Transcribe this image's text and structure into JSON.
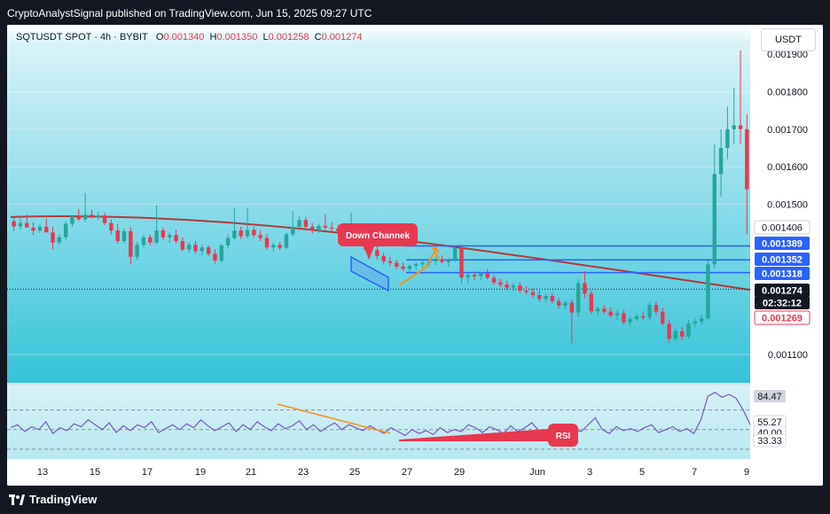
{
  "header": {
    "publisher_line": "CryptoAnalystSignal published on TradingView.com, Jun 15, 2025 09:27 UTC"
  },
  "legend": {
    "symbol": "SQTUSDT SPOT · 4h · BYBIT",
    "o_label": "O",
    "o_value": "0.001340",
    "h_label": "H",
    "h_value": "0.001350",
    "l_label": "L",
    "l_value": "0.001258",
    "c_label": "C",
    "c_value": "0.001274"
  },
  "currency": "USDT",
  "footer": {
    "brand": "TradingView"
  },
  "colors": {
    "up": "#26a69a",
    "down": "#e8384f",
    "ma": "#b33a3a",
    "level": "#2962ff",
    "orange": "#f7931a",
    "rsi": "#7e57c2",
    "label_red": "#e8384f",
    "label_dark": "#131722",
    "bg_top": "#d9f3f8",
    "bg_bottom": "#35c3d8"
  },
  "chart_data": {
    "type": "candlestick",
    "price_axis": {
      "ylim": [
        0.001,
        0.00193
      ],
      "ticks": [
        "0.001100",
        "0.001500",
        "0.001600",
        "0.001700",
        "0.001800",
        "0.001900"
      ]
    },
    "x_axis": {
      "ticks": [
        "13",
        "15",
        "17",
        "19",
        "21",
        "23",
        "25",
        "27",
        "29",
        "Jun",
        "3",
        "5",
        "7",
        "9"
      ]
    },
    "candles": [
      [
        0.001455,
        0.001465,
        0.001428,
        0.001441
      ],
      [
        0.001441,
        0.001462,
        0.001432,
        0.00145
      ],
      [
        0.00145,
        0.001472,
        0.00144,
        0.001438
      ],
      [
        0.001438,
        0.001452,
        0.001418,
        0.00143
      ],
      [
        0.00143,
        0.001448,
        0.001424,
        0.00144
      ],
      [
        0.00144,
        0.001462,
        0.00143,
        0.001425
      ],
      [
        0.001425,
        0.00144,
        0.00138,
        0.001398
      ],
      [
        0.001398,
        0.00142,
        0.001392,
        0.001412
      ],
      [
        0.001412,
        0.001455,
        0.001405,
        0.001448
      ],
      [
        0.001448,
        0.001472,
        0.00144,
        0.001468
      ],
      [
        0.001468,
        0.001488,
        0.001456,
        0.00146
      ],
      [
        0.00146,
        0.00153,
        0.001452,
        0.001472
      ],
      [
        0.001472,
        0.001485,
        0.001462,
        0.001466
      ],
      [
        0.001466,
        0.00148,
        0.001458,
        0.00147
      ],
      [
        0.00147,
        0.001478,
        0.001444,
        0.00145
      ],
      [
        0.00145,
        0.00146,
        0.00142,
        0.00143
      ],
      [
        0.00143,
        0.001448,
        0.001395,
        0.001402
      ],
      [
        0.001402,
        0.001435,
        0.001396,
        0.001428
      ],
      [
        0.001428,
        0.00144,
        0.00134,
        0.00136
      ],
      [
        0.00136,
        0.0014,
        0.001352,
        0.001392
      ],
      [
        0.001392,
        0.00142,
        0.001385,
        0.001412
      ],
      [
        0.001412,
        0.00142,
        0.00139,
        0.001398
      ],
      [
        0.001398,
        0.001498,
        0.001395,
        0.00143
      ],
      [
        0.00143,
        0.001438,
        0.001405,
        0.001412
      ],
      [
        0.001412,
        0.001425,
        0.001398,
        0.001418
      ],
      [
        0.001418,
        0.001432,
        0.001395,
        0.001402
      ],
      [
        0.001402,
        0.001412,
        0.001375,
        0.00138
      ],
      [
        0.00138,
        0.0014,
        0.00137,
        0.001392
      ],
      [
        0.001392,
        0.001402,
        0.001368,
        0.001375
      ],
      [
        0.001375,
        0.001392,
        0.001365,
        0.001385
      ],
      [
        0.001385,
        0.00139,
        0.001362,
        0.001368
      ],
      [
        0.001368,
        0.00138,
        0.001342,
        0.00135
      ],
      [
        0.00135,
        0.001395,
        0.001345,
        0.00139
      ],
      [
        0.00139,
        0.00142,
        0.001382,
        0.00141
      ],
      [
        0.00141,
        0.00149,
        0.001405,
        0.00143
      ],
      [
        0.00143,
        0.00144,
        0.001408,
        0.001415
      ],
      [
        0.001415,
        0.00149,
        0.00141,
        0.001432
      ],
      [
        0.001432,
        0.00144,
        0.001412,
        0.001418
      ],
      [
        0.001418,
        0.00143,
        0.001402,
        0.00141
      ],
      [
        0.00141,
        0.00142,
        0.001378,
        0.001385
      ],
      [
        0.001385,
        0.001398,
        0.001375,
        0.001392
      ],
      [
        0.001392,
        0.0014,
        0.001378,
        0.001384
      ],
      [
        0.001384,
        0.001425,
        0.00138,
        0.00142
      ],
      [
        0.00142,
        0.001482,
        0.001415,
        0.00144
      ],
      [
        0.00144,
        0.001468,
        0.00143,
        0.001458
      ],
      [
        0.001458,
        0.001466,
        0.001432,
        0.00144
      ],
      [
        0.00144,
        0.00145,
        0.001422,
        0.00143
      ],
      [
        0.00143,
        0.001448,
        0.001424,
        0.001442
      ],
      [
        0.001442,
        0.001474,
        0.001432,
        0.001438
      ],
      [
        0.001438,
        0.001452,
        0.001426,
        0.001436
      ],
      [
        0.001436,
        0.001446,
        0.00142,
        0.001428
      ],
      [
        0.001428,
        0.00144,
        0.001405,
        0.001412
      ],
      [
        0.001412,
        0.001478,
        0.001408,
        0.001418
      ],
      [
        0.001418,
        0.001428,
        0.001392,
        0.001398
      ],
      [
        0.001398,
        0.00141,
        0.00138,
        0.00139
      ],
      [
        0.00139,
        0.001402,
        0.00137,
        0.001378
      ],
      [
        0.001378,
        0.001388,
        0.001352,
        0.001362
      ],
      [
        0.001362,
        0.001372,
        0.00134,
        0.001348
      ],
      [
        0.001348,
        0.00136,
        0.001336,
        0.001344
      ],
      [
        0.001344,
        0.001352,
        0.001328,
        0.001334
      ],
      [
        0.001334,
        0.001345,
        0.001322,
        0.001328
      ],
      [
        0.001328,
        0.00134,
        0.001318,
        0.001336
      ],
      [
        0.001336,
        0.001346,
        0.001326,
        0.00134
      ],
      [
        0.00134,
        0.00135,
        0.00133,
        0.001344
      ],
      [
        0.001344,
        0.001356,
        0.001334,
        0.001348
      ],
      [
        0.001348,
        0.00136,
        0.001338,
        0.001352
      ],
      [
        0.001352,
        0.001364,
        0.001342,
        0.001346
      ],
      [
        0.001346,
        0.001358,
        0.001334,
        0.001352
      ],
      [
        0.001352,
        0.00139,
        0.001346,
        0.001384
      ],
      [
        0.001384,
        0.001392,
        0.00129,
        0.001305
      ],
      [
        0.001305,
        0.001318,
        0.00129,
        0.001312
      ],
      [
        0.001312,
        0.001322,
        0.001298,
        0.001308
      ],
      [
        0.001308,
        0.00132,
        0.001298,
        0.001316
      ],
      [
        0.001316,
        0.001328,
        0.0013,
        0.001304
      ],
      [
        0.001304,
        0.001312,
        0.001285,
        0.001292
      ],
      [
        0.001292,
        0.001302,
        0.00128,
        0.001286
      ],
      [
        0.001286,
        0.001296,
        0.001272,
        0.001278
      ],
      [
        0.001278,
        0.00129,
        0.001268,
        0.001284
      ],
      [
        0.001284,
        0.001292,
        0.001264,
        0.00127
      ],
      [
        0.00127,
        0.001282,
        0.00126,
        0.001266
      ],
      [
        0.001266,
        0.001276,
        0.001252,
        0.001258
      ],
      [
        0.001258,
        0.00127,
        0.00124,
        0.001248
      ],
      [
        0.001248,
        0.001262,
        0.001238,
        0.001256
      ],
      [
        0.001256,
        0.001264,
        0.001236,
        0.001242
      ],
      [
        0.001242,
        0.00125,
        0.001222,
        0.00123
      ],
      [
        0.00123,
        0.001244,
        0.00122,
        0.001238
      ],
      [
        0.001238,
        0.001246,
        0.00113,
        0.001212
      ],
      [
        0.001212,
        0.0013,
        0.0012,
        0.00129
      ],
      [
        0.00129,
        0.001322,
        0.00125,
        0.001262
      ],
      [
        0.001262,
        0.00127,
        0.001208,
        0.001215
      ],
      [
        0.001215,
        0.001228,
        0.001205,
        0.001222
      ],
      [
        0.001222,
        0.001232,
        0.001208,
        0.001214
      ],
      [
        0.001214,
        0.001225,
        0.001198,
        0.001204
      ],
      [
        0.001204,
        0.001218,
        0.001192,
        0.00121
      ],
      [
        0.00121,
        0.00122,
        0.00118,
        0.001186
      ],
      [
        0.001186,
        0.0012,
        0.001174,
        0.001194
      ],
      [
        0.001194,
        0.00121,
        0.001188,
        0.001202
      ],
      [
        0.001202,
        0.001214,
        0.00119,
        0.001198
      ],
      [
        0.001198,
        0.00124,
        0.001192,
        0.001232
      ],
      [
        0.001232,
        0.00124,
        0.001205,
        0.001214
      ],
      [
        0.001214,
        0.001224,
        0.001176,
        0.001182
      ],
      [
        0.001182,
        0.001192,
        0.00113,
        0.001142
      ],
      [
        0.001142,
        0.00117,
        0.001136,
        0.001162
      ],
      [
        0.001162,
        0.001174,
        0.001138,
        0.001148
      ],
      [
        0.001148,
        0.001192,
        0.001142,
        0.001182
      ],
      [
        0.001182,
        0.001196,
        0.001174,
        0.001188
      ],
      [
        0.001188,
        0.001206,
        0.001178,
        0.001196
      ],
      [
        0.001196,
        0.00135,
        0.00119,
        0.00134
      ],
      [
        0.00134,
        0.00166,
        0.00133,
        0.00158
      ],
      [
        0.00158,
        0.0017,
        0.00152,
        0.00165
      ],
      [
        0.00165,
        0.00176,
        0.00162,
        0.0017
      ],
      [
        0.0017,
        0.00181,
        0.00166,
        0.00171
      ],
      [
        0.00171,
        0.00191,
        0.00166,
        0.0017
      ],
      [
        0.0017,
        0.00174,
        0.00142,
        0.00154
      ]
    ],
    "moving_average_start": 0.001466,
    "moving_average_end": 0.001272,
    "horizontal_levels": [
      0.001389,
      0.001352,
      0.001318
    ],
    "last_close": 0.001274,
    "price_labels": [
      {
        "value": "0.001406",
        "style": "plain"
      },
      {
        "value": "0.001389",
        "style": "blue"
      },
      {
        "value": "0.001352",
        "style": "blue"
      },
      {
        "value": "0.001318",
        "style": "blue"
      },
      {
        "value": "0.001274",
        "style": "dark"
      },
      {
        "value": "02:32:12",
        "style": "dark"
      },
      {
        "value": "0.001269",
        "style": "red-outline"
      }
    ],
    "annotations": {
      "down_channel": "Down Channek",
      "rsi_label": "RSI"
    },
    "rsi": {
      "values": [
        52,
        55,
        48,
        53,
        50,
        58,
        46,
        52,
        49,
        56,
        53,
        60,
        55,
        50,
        57,
        47,
        54,
        49,
        55,
        52,
        58,
        47,
        51,
        55,
        50,
        56,
        52,
        60,
        54,
        49,
        53,
        57,
        48,
        55,
        50,
        58,
        53,
        49,
        56,
        51,
        54,
        59,
        50,
        55,
        48,
        53,
        57,
        50,
        55,
        52,
        49,
        54,
        50,
        46,
        52,
        48,
        44,
        50,
        46,
        49,
        45,
        52,
        47,
        50,
        48,
        55,
        52,
        47,
        53,
        50,
        46,
        54,
        48,
        52,
        57,
        49,
        45,
        51,
        47,
        53,
        50,
        48,
        55,
        62,
        50,
        46,
        53,
        49,
        51,
        48,
        52,
        55,
        47,
        50,
        53,
        48,
        51,
        46,
        60,
        84,
        88,
        83,
        86,
        82,
        70,
        55
      ],
      "axis_labels": [
        "84.47",
        "55.27",
        "40.00",
        "33.33"
      ],
      "ylim": [
        20,
        95
      ]
    }
  }
}
